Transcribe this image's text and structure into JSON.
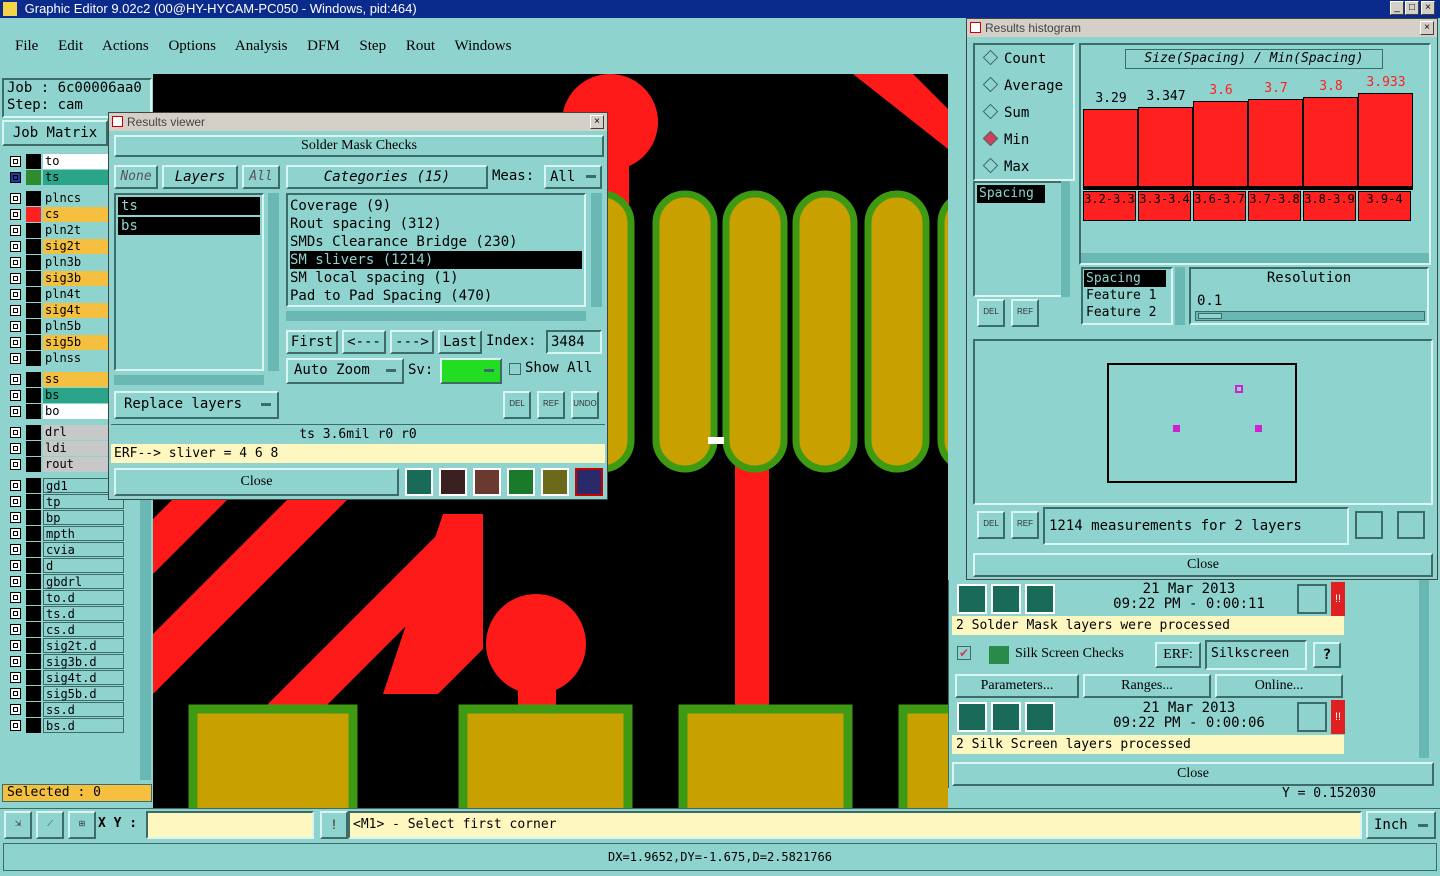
{
  "app": {
    "title": "Graphic Editor 9.02c2 (00@HY-HYCAM-PC050 - Windows, pid:464)",
    "menu": [
      "File",
      "Edit",
      "Actions",
      "Options",
      "Analysis",
      "DFM",
      "Step",
      "Rout",
      "Windows"
    ]
  },
  "job": {
    "job_label": "Job : 6c00006aa0",
    "step_label": "Step: cam",
    "matrix_button": "Job Matrix"
  },
  "layers": [
    {
      "name": "to",
      "swatch": "#000000",
      "bg": "#ffffff",
      "group": 1
    },
    {
      "name": "ts",
      "swatch": "#2e8b2e",
      "bg": "#2aa58a",
      "group": 1,
      "selected": true
    },
    {
      "name": "plncs",
      "swatch": "#000000",
      "bg": "#8fd3cf",
      "group": 2
    },
    {
      "name": "cs",
      "swatch": "#ff2020",
      "bg": "#f5c040",
      "group": 2
    },
    {
      "name": "pln2t",
      "swatch": "#000000",
      "bg": "#8fd3cf",
      "group": 2
    },
    {
      "name": "sig2t",
      "swatch": "#000000",
      "bg": "#f5c040",
      "group": 2
    },
    {
      "name": "pln3b",
      "swatch": "#000000",
      "bg": "#8fd3cf",
      "group": 2
    },
    {
      "name": "sig3b",
      "swatch": "#000000",
      "bg": "#f5c040",
      "group": 2
    },
    {
      "name": "pln4t",
      "swatch": "#000000",
      "bg": "#8fd3cf",
      "group": 2
    },
    {
      "name": "sig4t",
      "swatch": "#000000",
      "bg": "#f5c040",
      "group": 2
    },
    {
      "name": "pln5b",
      "swatch": "#000000",
      "bg": "#8fd3cf",
      "group": 2
    },
    {
      "name": "sig5b",
      "swatch": "#000000",
      "bg": "#f5c040",
      "group": 2
    },
    {
      "name": "plnss",
      "swatch": "#000000",
      "bg": "#8fd3cf",
      "group": 2
    },
    {
      "name": "ss",
      "swatch": "#000000",
      "bg": "#f5c040",
      "group": 3
    },
    {
      "name": "bs",
      "swatch": "#000000",
      "bg": "#2aa58a",
      "group": 3
    },
    {
      "name": "bo",
      "swatch": "#000000",
      "bg": "#ffffff",
      "group": 3
    },
    {
      "name": "drl",
      "swatch": "#000000",
      "bg": "#c8c8c8",
      "group": 4
    },
    {
      "name": "ldi",
      "swatch": "#000000",
      "bg": "#c8c8c8",
      "group": 4
    },
    {
      "name": "rout",
      "swatch": "#000000",
      "bg": "#c8c8c8",
      "group": 4
    },
    {
      "name": "gd1",
      "swatch": "#000000",
      "bg": "#8fd3cf",
      "group": 5
    },
    {
      "name": "tp",
      "swatch": "#000000",
      "bg": "#8fd3cf",
      "group": 5
    },
    {
      "name": "bp",
      "swatch": "#000000",
      "bg": "#8fd3cf",
      "group": 5
    },
    {
      "name": "mpth",
      "swatch": "#000000",
      "bg": "#8fd3cf",
      "group": 5
    },
    {
      "name": "cvia",
      "swatch": "#000000",
      "bg": "#8fd3cf",
      "group": 5
    },
    {
      "name": "d",
      "swatch": "#000000",
      "bg": "#8fd3cf",
      "group": 5
    },
    {
      "name": "gbdrl",
      "swatch": "#000000",
      "bg": "#8fd3cf",
      "group": 5
    },
    {
      "name": "to.d",
      "swatch": "#000000",
      "bg": "#8fd3cf",
      "group": 5
    },
    {
      "name": "ts.d",
      "swatch": "#000000",
      "bg": "#8fd3cf",
      "group": 5
    },
    {
      "name": "cs.d",
      "swatch": "#000000",
      "bg": "#8fd3cf",
      "group": 5
    },
    {
      "name": "sig2t.d",
      "swatch": "#000000",
      "bg": "#8fd3cf",
      "group": 5
    },
    {
      "name": "sig3b.d",
      "swatch": "#000000",
      "bg": "#8fd3cf",
      "group": 5
    },
    {
      "name": "sig4t.d",
      "swatch": "#000000",
      "bg": "#8fd3cf",
      "group": 5
    },
    {
      "name": "sig5b.d",
      "swatch": "#000000",
      "bg": "#8fd3cf",
      "group": 5
    },
    {
      "name": "ss.d",
      "swatch": "#000000",
      "bg": "#8fd3cf",
      "group": 5
    },
    {
      "name": "bs.d",
      "swatch": "#000000",
      "bg": "#8fd3cf",
      "group": 5
    }
  ],
  "status": {
    "selected": "Selected : 0",
    "xy_label": "X Y :",
    "prompt": "<M1> - Select first corner",
    "units": "Inch",
    "measure": "DX=1.9652,DY=-1.675,D=2.5821766",
    "coord_y": "Y = 0.152030"
  },
  "results_viewer": {
    "title": "Results viewer",
    "header": "Solder Mask Checks",
    "none_btn": "None",
    "layers_btn": "Layers",
    "all_btn": "All",
    "categories_btn": "Categories (15)",
    "meas_label": "Meas:",
    "meas_value": "All",
    "layer_items": [
      "ts",
      "bs"
    ],
    "categories": [
      "Coverage (9)",
      "Rout spacing (312)",
      "SMDs Clearance Bridge (230)",
      "SM slivers (1214)",
      "SM local spacing (1)",
      "Pad to Pad Spacing (470)"
    ],
    "nav": {
      "first": "First",
      "prev": "<---",
      "next": "--->",
      "last": "Last",
      "index_label": "Index:",
      "index_value": "3484"
    },
    "auto_zoom": "Auto Zoom",
    "sv_label": "Sv:",
    "show_all": "Show All",
    "replace_layers": "Replace layers",
    "del": "DEL",
    "ref": "REF",
    "undo": "UNDO",
    "info": "ts 3.6mil  r0  r0",
    "erf": "ERF--> sliver = 4 6 8",
    "close": "Close"
  },
  "histogram": {
    "title": "Results histogram",
    "options": [
      "Count",
      "Average",
      "Sum",
      "Min",
      "Max"
    ],
    "selected_option": "Min",
    "chart_title": "Size(Spacing) / Min(Spacing)",
    "list_item": "Spacing",
    "fields": [
      "Spacing",
      "Feature 1",
      "Feature 2"
    ],
    "resolution_label": "Resolution",
    "resolution_value": "0.1",
    "summary": "1214 measurements for 2 layers",
    "close": "Close",
    "del": "DEL",
    "ref": "REF"
  },
  "chart_data": {
    "type": "bar",
    "title": "Size(Spacing) / Min(Spacing)",
    "categories": [
      "3.2-3.3",
      "3.3-3.4",
      "3.6-3.7",
      "3.7-3.8",
      "3.8-3.9",
      "3.9-4"
    ],
    "values": [
      3.29,
      3.347,
      3.6,
      3.7,
      3.8,
      3.933
    ],
    "value_labels": [
      "3.29",
      "3.347",
      "3.6",
      "3.7",
      "3.8",
      "3.933"
    ],
    "label_colors": [
      "#000000",
      "#000000",
      "#ff2020",
      "#ff2020",
      "#ff2020",
      "#ff2020"
    ],
    "ylim": [
      0,
      4.2
    ]
  },
  "checks": {
    "sm_date": "21 Mar 2013",
    "sm_time": "09:22 PM - 0:00:11",
    "sm_status": "2 Solder Mask layers were processed",
    "ss_name": "Silk Screen Checks",
    "erf_label": "ERF:",
    "erf_value": "Silkscreen",
    "help": "?",
    "parameters": "Parameters...",
    "ranges": "Ranges...",
    "online": "Online...",
    "ss_date": "21 Mar 2013",
    "ss_time": "09:22 PM - 0:00:06",
    "ss_status": "2 Silk Screen layers processed",
    "close": "Close",
    "alert": "!!"
  }
}
